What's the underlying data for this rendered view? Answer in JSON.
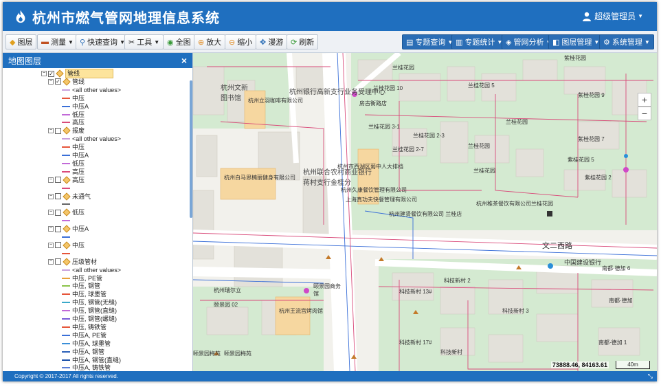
{
  "app": {
    "title": "杭州市燃气管网地理信息系统",
    "user": "超级管理员"
  },
  "toolbar": {
    "layers": "图层",
    "measure": "测量",
    "quick_query": "快速查询",
    "tools": "工具",
    "full": "全图",
    "zoom_in": "放大",
    "zoom_out": "缩小",
    "pan": "漫游",
    "refresh": "刷新",
    "topic_query": "专题查询",
    "topic_stats": "专题统计",
    "pipe_analysis": "管网分析",
    "layer_mgmt": "图层管理",
    "sys_mgmt": "系统管理"
  },
  "sidebar": {
    "title": "地图图层",
    "close": "×"
  },
  "tree": [
    {
      "label": "管线",
      "level": 0,
      "pm": "⊟",
      "cb": "✓",
      "kind": "root"
    },
    {
      "label": "管线",
      "level": 1,
      "pm": "⊟",
      "cb": "✓",
      "kind": "group"
    },
    {
      "label": "<all other values>",
      "level": 2,
      "color": "#c9a0dc"
    },
    {
      "label": "中压",
      "level": 2,
      "color": "#e6553a"
    },
    {
      "label": "中压A",
      "level": 2,
      "color": "#3a6fd8"
    },
    {
      "label": "低压",
      "level": 2,
      "color": "#c26ad8"
    },
    {
      "label": "高压",
      "level": 2,
      "color": "#d94b7a"
    },
    {
      "label": "报废",
      "level": 1,
      "pm": "⊟",
      "cb": "",
      "kind": "group"
    },
    {
      "label": "<all other values>",
      "level": 2,
      "color": "#c9a0dc"
    },
    {
      "label": "中压",
      "level": 2,
      "color": "#e6553a"
    },
    {
      "label": "中压A",
      "level": 2,
      "color": "#3a6fd8"
    },
    {
      "label": "低压",
      "level": 2,
      "color": "#c26ad8"
    },
    {
      "label": "高压",
      "level": 2,
      "color": "#d94b7a"
    },
    {
      "label": "高压",
      "level": 1,
      "pm": "⊟",
      "cb": "",
      "kind": "group"
    },
    {
      "label": "",
      "level": 2,
      "color": "#d94b7a"
    },
    {
      "label": "未通气",
      "level": 1,
      "pm": "⊟",
      "cb": "",
      "kind": "group"
    },
    {
      "label": "",
      "level": 2,
      "color": "#666666"
    },
    {
      "label": "低压",
      "level": 1,
      "pm": "⊟",
      "cb": "",
      "kind": "group"
    },
    {
      "label": "",
      "level": 2,
      "color": "#c26ad8"
    },
    {
      "label": "中压A",
      "level": 1,
      "pm": "⊟",
      "cb": "",
      "kind": "group"
    },
    {
      "label": "",
      "level": 2,
      "color": "#3a6fd8"
    },
    {
      "label": "中压",
      "level": 1,
      "pm": "⊟",
      "cb": "",
      "kind": "group"
    },
    {
      "label": "",
      "level": 2,
      "color": "#e6553a"
    },
    {
      "label": "压级管材",
      "level": 1,
      "pm": "⊟",
      "cb": "",
      "kind": "group"
    },
    {
      "label": "<all other values>",
      "level": 2,
      "color": "#c9a0dc"
    },
    {
      "label": "中压, PE管",
      "level": 2,
      "color": "#e8a13a"
    },
    {
      "label": "中压, 钢管",
      "level": 2,
      "color": "#8bc34a"
    },
    {
      "label": "中压, 球墨管",
      "level": 2,
      "color": "#e6553a"
    },
    {
      "label": "中压, 钢管(无缝)",
      "level": 2,
      "color": "#3aa9c9"
    },
    {
      "label": "中压, 钢管(直缝)",
      "level": 2,
      "color": "#c26ad8"
    },
    {
      "label": "中压, 钢管(螺缝)",
      "level": 2,
      "color": "#7a5bd8"
    },
    {
      "label": "中压, 铸铁管",
      "level": 2,
      "color": "#e6553a"
    },
    {
      "label": "中压A, PE管",
      "level": 2,
      "color": "#3a6fd8"
    },
    {
      "label": "中压A, 球墨管",
      "level": 2,
      "color": "#3a8fd8"
    },
    {
      "label": "中压A, 钢管",
      "level": 2,
      "color": "#2a5fb8"
    },
    {
      "label": "中压A, 钢管(直缝)",
      "level": 2,
      "color": "#1a4fa8"
    },
    {
      "label": "中压A, 铸铁管",
      "level": 2,
      "color": "#5a7fd8"
    }
  ],
  "map": {
    "road_main": "文二西路",
    "pois": [
      "杭州立羽咖啡有限公司",
      "杭州白马思楠丽健身有限公司",
      "杭州市西湖区葡中人大排档",
      "杭州久康餐饮管理有限公司",
      "上海真功夫快餐管理有限公司",
      "杭州建贤餐饮有限公司 兰桂店",
      "杭州稚茶餐饮有限公司兰桂花园",
      "杭州王流宫烤肉馆",
      "中国建设银行"
    ],
    "places": [
      "兰桂花园",
      "兰桂花园 5",
      "兰桂花园 10",
      "兰桂花园 3-1",
      "兰桂花园 2-3",
      "兰桂花园 2-7",
      "紫桂花园",
      "紫桂花园 9",
      "紫桂花园 7",
      "紫桂花园 5",
      "紫桂花园 2",
      "科技新村",
      "科技新村 2",
      "科技新村 3",
      "科技新村 13#",
      "科技新村 17#",
      "南都·德加",
      "南都·德加 6",
      "南都·德加 1",
      "颐景园",
      "颐景园 02",
      "颐景园梅苑",
      "杭州银行高新支行业务受理中心",
      "杭州联合农村商业银行蒋村支行金桂分",
      "房古衡路店",
      "杭州文新图书馆",
      "杭州瑞尔立",
      "颐景园商务馆"
    ],
    "zoom_in": "+",
    "zoom_out": "−",
    "coords": "73888.46, 84163.61",
    "scale": "40m"
  },
  "footer": {
    "copyright": "Copyright © 2017-2017 All rights reserved."
  },
  "colors": {
    "header": "#1f6fbf",
    "park": "#cfe8cf",
    "building": "#e7e4dc",
    "poi_block": "#f8d9a3"
  }
}
